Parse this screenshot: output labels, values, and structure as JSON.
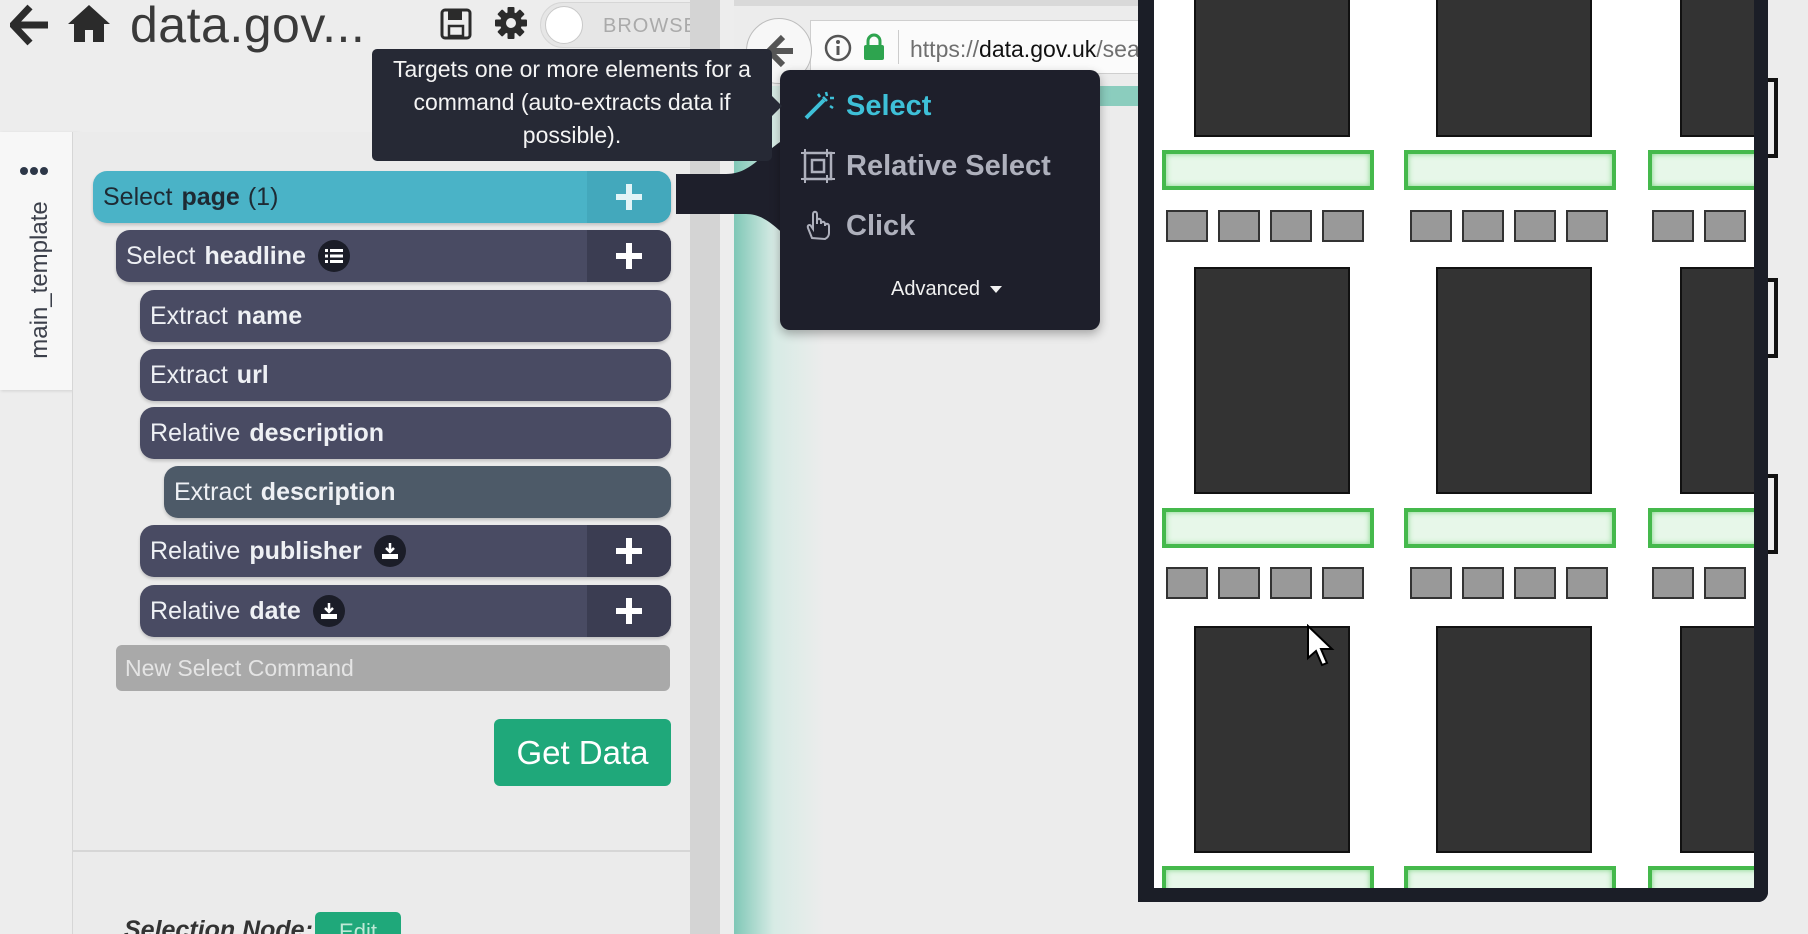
{
  "app": {
    "title": "data.gov...",
    "browse_label": "BROWSE"
  },
  "icons": {
    "back": "back-arrow-icon",
    "home": "home-icon",
    "save": "save-icon",
    "settings": "gear-icon",
    "dots": "more-dots-icon"
  },
  "template_tab": {
    "label": "main_template"
  },
  "commands": [
    {
      "verb": "Select",
      "noun": "page",
      "count": "(1)"
    },
    {
      "verb": "Select",
      "noun": "headline"
    },
    {
      "verb": "Extract",
      "noun": "name"
    },
    {
      "verb": "Extract",
      "noun": "url"
    },
    {
      "verb": "Relative",
      "noun": "description"
    },
    {
      "verb": "Extract",
      "noun": "description"
    },
    {
      "verb": "Relative",
      "noun": "publisher"
    },
    {
      "verb": "Relative",
      "noun": "date"
    }
  ],
  "new_select_placeholder": "New Select Command",
  "get_data_label": "Get Data",
  "selection_node_label": "Selection Node:",
  "edit_label": "Edit",
  "tooltip": {
    "text": "Targets one or more elements for a command (auto-extracts data if possible)."
  },
  "menu": {
    "items": [
      {
        "label": "Select",
        "icon": "magic-wand-icon",
        "active": true
      },
      {
        "label": "Relative Select",
        "icon": "relative-select-icon",
        "active": false
      },
      {
        "label": "Click",
        "icon": "pointer-hand-icon",
        "active": false
      }
    ],
    "advanced_label": "Advanced"
  },
  "browser": {
    "url_prefix": "https://",
    "url_domain": "data.gov.uk",
    "url_rest": "/sear"
  },
  "colors": {
    "select_accent": "#4ab3c7",
    "command_bg": "#494b63",
    "get_data_green": "#1fa87a",
    "highlight_green": "#45b94c"
  }
}
